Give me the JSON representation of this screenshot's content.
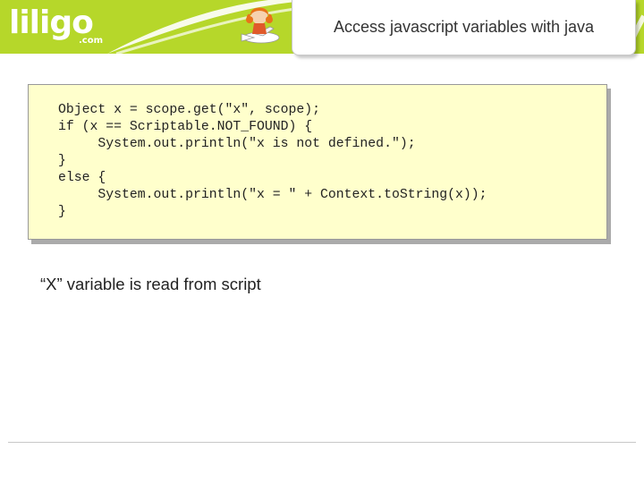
{
  "header": {
    "logo_name": "liligo",
    "logo_tld": ".com",
    "title": "Access javascript variables with java",
    "colors": {
      "band": "#b6d72a",
      "swoosh": "#ffffff"
    }
  },
  "code": {
    "lines": [
      "Object x = scope.get(\"x\", scope);",
      "if (x == Scriptable.NOT_FOUND) {",
      "     System.out.println(\"x is not defined.\");",
      "}",
      "else {",
      "     System.out.println(\"x = \" + Context.toString(x));",
      "}"
    ],
    "colors": {
      "background": "#ffffcc",
      "border": "#999999"
    }
  },
  "caption": "“X” variable is read from script",
  "icons": {
    "mascot": "girl-on-plane-mascot-icon"
  }
}
